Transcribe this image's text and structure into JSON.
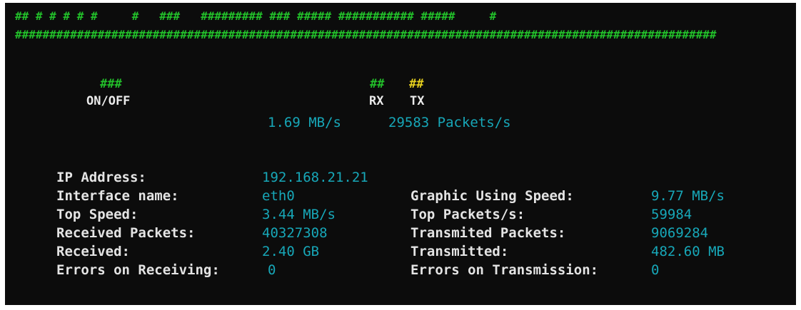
{
  "graph": {
    "top_row": "## # # # # #     #   ###   ######### ### ##### ########### #####     #",
    "base_row": "######################################################################################################"
  },
  "legend": {
    "onoff_marker": "###",
    "onoff_label": "ON/OFF",
    "rx_marker": "##",
    "rx_label": "RX",
    "tx_marker": "##",
    "tx_label": "TX",
    "colors": {
      "onoff": "#22c02a",
      "rx": "#22c02a",
      "tx": "#e6d01e"
    }
  },
  "current": {
    "speed": "1.69 MB/s",
    "packets": "29583 Packets/s"
  },
  "stats_left": [
    {
      "label": "IP Address:",
      "value": "192.168.21.21"
    },
    {
      "label": "Interface name:",
      "value": "eth0"
    },
    {
      "label": "Top Speed:",
      "value": "3.44 MB/s"
    },
    {
      "label": "Received Packets:",
      "value": "40327308"
    },
    {
      "label": "Received:",
      "value": "2.40 GB"
    },
    {
      "label": "Errors on Receiving:",
      "value": "0"
    }
  ],
  "stats_right": [
    {
      "label": "Graphic Using Speed:",
      "value": "9.77 MB/s"
    },
    {
      "label": "Top Packets/s:",
      "value": "59984"
    },
    {
      "label": "Transmited Packets:",
      "value": "9069284"
    },
    {
      "label": "Transmitted:",
      "value": "482.60 MB"
    },
    {
      "label": "Errors on Transmission:",
      "value": "0"
    }
  ]
}
